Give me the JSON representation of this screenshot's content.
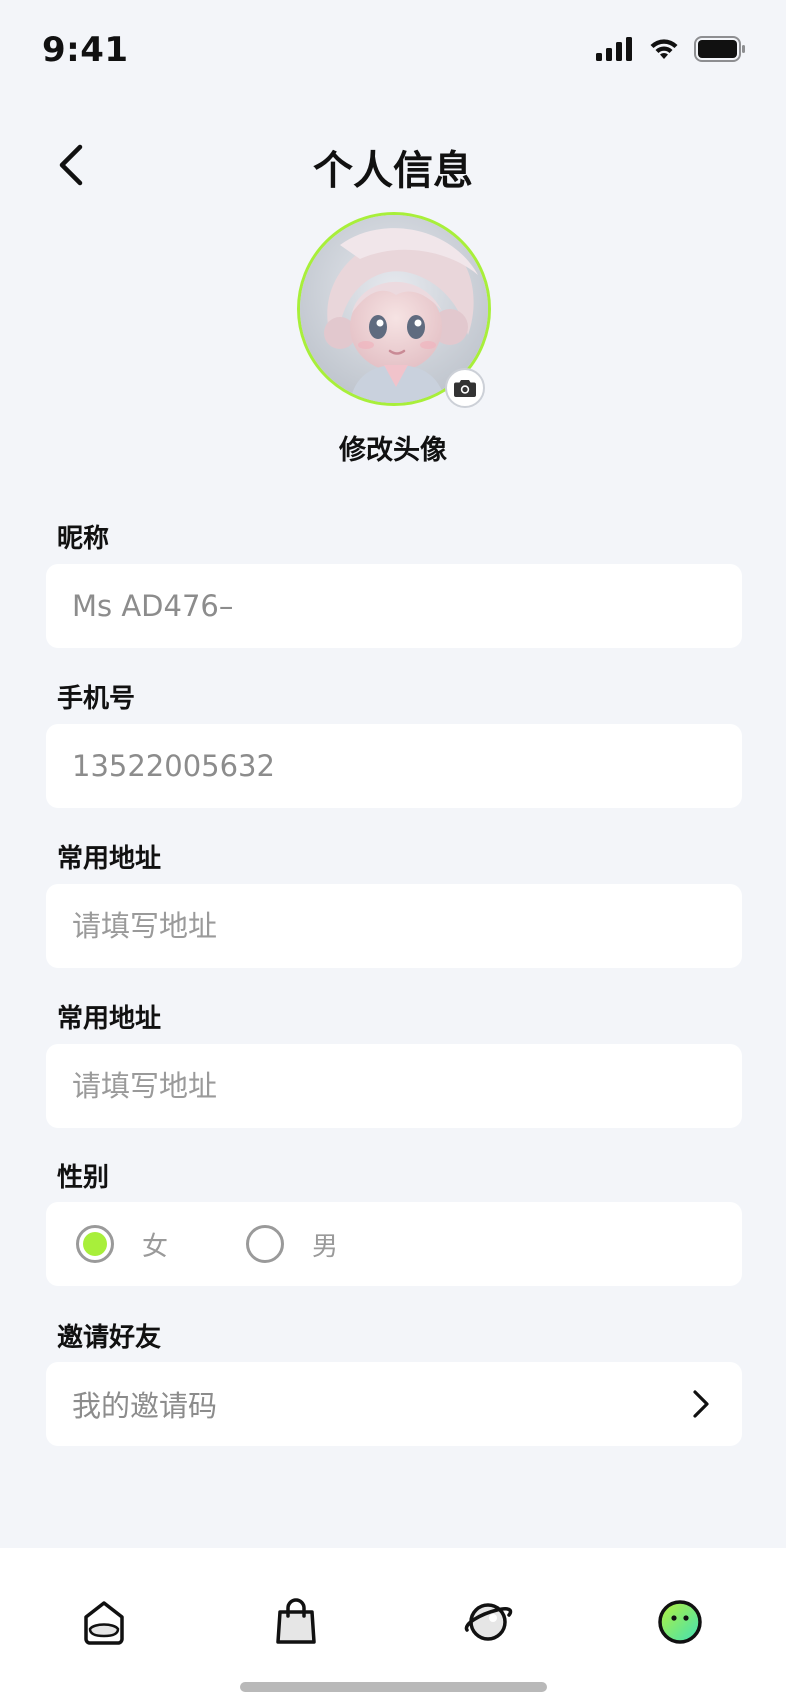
{
  "status_bar": {
    "time": "9:41"
  },
  "header": {
    "title": "个人信息"
  },
  "avatar": {
    "change_label": "修改头像"
  },
  "form": {
    "nickname": {
      "label": "昵称",
      "value": "Ms AD476–"
    },
    "phone": {
      "label": "手机号",
      "value": "13522005632"
    },
    "address1": {
      "label": "常用地址",
      "placeholder": "请填写地址"
    },
    "address2": {
      "label": "常用地址",
      "placeholder": "请填写地址"
    },
    "gender": {
      "label": "性别",
      "options": [
        "女",
        "男"
      ],
      "selected": "女"
    },
    "invite": {
      "label": "邀请好友",
      "value": "我的邀请码"
    }
  },
  "tab_bar": {
    "items": [
      "home-icon",
      "shopping-bag-icon",
      "planet-icon",
      "profile-face-icon"
    ],
    "active": "profile-face-icon"
  },
  "colors": {
    "accent": "#a8ef3a",
    "background": "#f3f5f9"
  }
}
